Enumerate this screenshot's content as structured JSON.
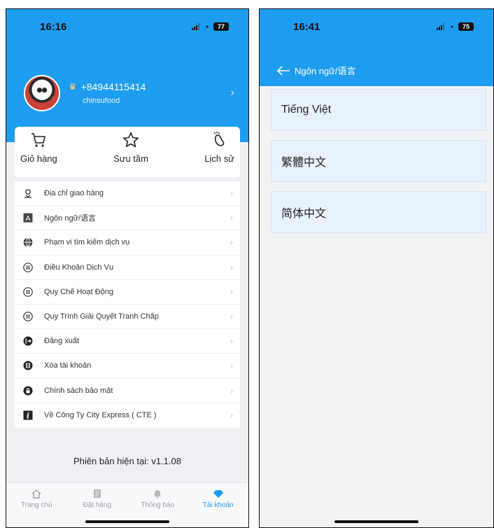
{
  "left_screen": {
    "status_bar": {
      "time": "16:16",
      "battery": "77"
    },
    "profile": {
      "phone_number": "+84944115414",
      "username": "chinsufood"
    },
    "shortcuts": [
      {
        "icon": "cart-icon",
        "label": "Giỏ hàng"
      },
      {
        "icon": "star-icon",
        "label": "Sưu tầm"
      },
      {
        "icon": "footprint-icon",
        "label": "Lịch sử"
      }
    ],
    "menu_items": [
      {
        "icon": "location-icon",
        "label": "Địa chỉ giao hàng"
      },
      {
        "icon": "language-icon",
        "label": "Ngôn ngữ/语言"
      },
      {
        "icon": "globe-icon",
        "label": "Phạm vi tìm kiếm dịch vụ"
      },
      {
        "icon": "list-icon",
        "label": "Điều Khoản Dịch Vụ"
      },
      {
        "icon": "list-icon",
        "label": "Quy Chế Hoạt Động"
      },
      {
        "icon": "list-icon",
        "label": "Quy Trình Giải Quyết Tranh Chấp"
      },
      {
        "icon": "logout-icon",
        "label": "Đăng xuất"
      },
      {
        "icon": "trash-icon",
        "label": "Xóa tài khoản"
      },
      {
        "icon": "lock-icon",
        "label": "Chính sách bảo mật"
      },
      {
        "icon": "info-icon",
        "label": "Về Công Ty City Express ( CTE )"
      }
    ],
    "version_text": "Phiên bản hiện tại: v1.1.08",
    "tabs": [
      {
        "icon": "home-icon",
        "label": "Trang chủ",
        "active": false
      },
      {
        "icon": "orders-icon",
        "label": "Đặt hàng",
        "active": false
      },
      {
        "icon": "bell-icon",
        "label": "Thông báo",
        "active": false
      },
      {
        "icon": "diamond-icon",
        "label": "Tài khoản",
        "active": true
      }
    ]
  },
  "right_screen": {
    "status_bar": {
      "time": "16:41",
      "battery": "75"
    },
    "nav_title": "Ngôn ngữ/语言",
    "languages": [
      "Tiếng Việt",
      "繁體中文",
      "简体中文"
    ]
  },
  "colors": {
    "primary": "#1e9cf0",
    "background": "#eef0f4",
    "option_bg": "#e8f2fc"
  }
}
